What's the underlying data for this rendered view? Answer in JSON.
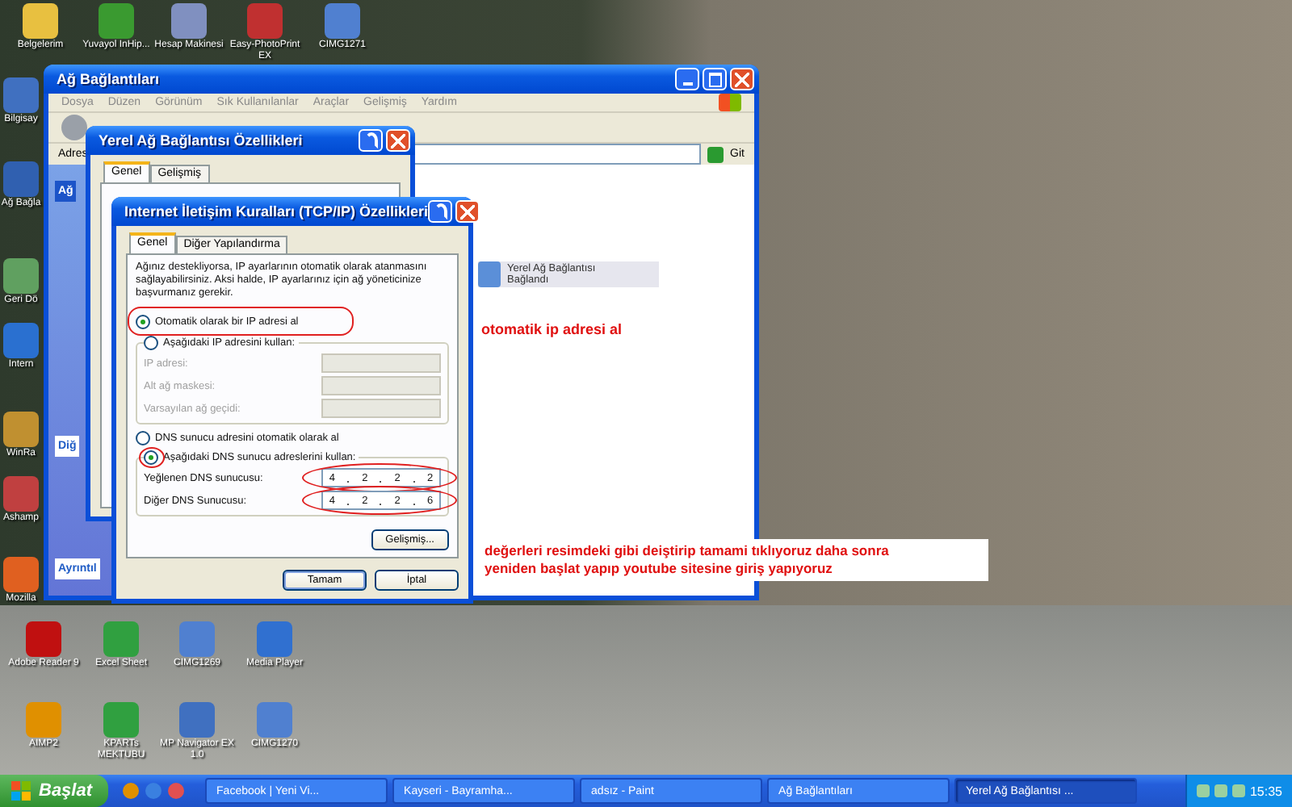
{
  "desktop_icons": [
    {
      "label": "Belgelerim"
    },
    {
      "label": "Yuvayol InHip..."
    },
    {
      "label": "Hesap Makinesi"
    },
    {
      "label": "Easy-PhotoPrint EX"
    },
    {
      "label": "CIMG1271"
    },
    {
      "label": "Bilgisay"
    },
    {
      "label": "Ağ Bağla"
    },
    {
      "label": "Geri Dö"
    },
    {
      "label": "Intern"
    },
    {
      "label": "WinRa"
    },
    {
      "label": "Ashamp"
    },
    {
      "label": "Mozilla"
    },
    {
      "label": "Adobe Reader 9"
    },
    {
      "label": "Excel Sheet"
    },
    {
      "label": "CIMG1269"
    },
    {
      "label": "Media Player"
    },
    {
      "label": "AIMP2"
    },
    {
      "label": "KPARTs MEKTUBU"
    },
    {
      "label": "MP Navigator EX 1.0"
    },
    {
      "label": "CIMG1270"
    }
  ],
  "network_window": {
    "title": "Ağ Bağlantıları",
    "menu": [
      "Dosya",
      "Düzen",
      "Görünüm",
      "Sık Kullanılanlar",
      "Araçlar",
      "Gelişmiş",
      "Yardım"
    ],
    "address_label": "Adres",
    "go_button": "Git",
    "sidebar_sections": [
      "Ağ",
      "Diğ",
      "Ayrıntıl"
    ],
    "connection": {
      "name": "Yerel Ağ Bağlantısı",
      "status": "Bağlandı"
    }
  },
  "properties_dialog": {
    "title": "Yerel Ağ Bağlantısı Özellikleri",
    "tabs": [
      {
        "label": "Genel",
        "selected": true
      },
      {
        "label": "Gelişmiş",
        "selected": false
      }
    ]
  },
  "tcpip_dialog": {
    "title": "Internet İletişim Kuralları (TCP/IP) Özellikleri",
    "tabs": [
      {
        "label": "Genel",
        "selected": true
      },
      {
        "label": "Diğer Yapılandırma",
        "selected": false
      }
    ],
    "intro": "Ağınız destekliyorsa, IP ayarlarının otomatik olarak atanmasını sağlayabilirsiniz. Aksi halde, IP ayarlarınız için ağ yöneticinize başvurmanız gerekir.",
    "ip_options": [
      {
        "label": "Otomatik olarak bir IP adresi al",
        "selected": true
      },
      {
        "label": "Aşağıdaki IP adresini kullan:",
        "selected": false
      }
    ],
    "ip_fields": [
      {
        "label": "IP adresi:",
        "disabled": true
      },
      {
        "label": "Alt ağ maskesi:",
        "disabled": true
      },
      {
        "label": "Varsayılan ağ geçidi:",
        "disabled": true
      }
    ],
    "dns_options": [
      {
        "label": "DNS sunucu adresini otomatik olarak al",
        "selected": false
      },
      {
        "label": "Aşağıdaki DNS sunucu adreslerini kullan:",
        "selected": true
      }
    ],
    "dns_fields": [
      {
        "label": "Yeğlenen DNS sunucusu:",
        "disabled": false,
        "value": [
          "4",
          "2",
          "2",
          "2"
        ]
      },
      {
        "label": "Diğer DNS Sunucusu:",
        "disabled": false,
        "value": [
          "4",
          "2",
          "2",
          "6"
        ]
      }
    ],
    "advanced_button": "Gelişmiş...",
    "buttons": [
      "Tamam",
      "İptal"
    ]
  },
  "annotations": {
    "ip_note": "otomatik ip adresi al",
    "dns_note": [
      "değerleri resimdeki gibi deiştirip tamami tıklıyoruz daha sonra",
      "yeniden başlat yapıp youtube sitesine giriş yapıyoruz"
    ]
  },
  "taskbar": {
    "start": "Başlat",
    "tasks": [
      {
        "label": "Facebook | Yeni Vi...",
        "selected": false
      },
      {
        "label": "Kayseri - Bayramha...",
        "selected": false
      },
      {
        "label": "adsız - Paint",
        "selected": false
      },
      {
        "label": "Ağ Bağlantıları",
        "selected": false
      },
      {
        "label": "Yerel Ağ Bağlantısı ...",
        "selected": true
      }
    ],
    "clock": "15:35"
  }
}
